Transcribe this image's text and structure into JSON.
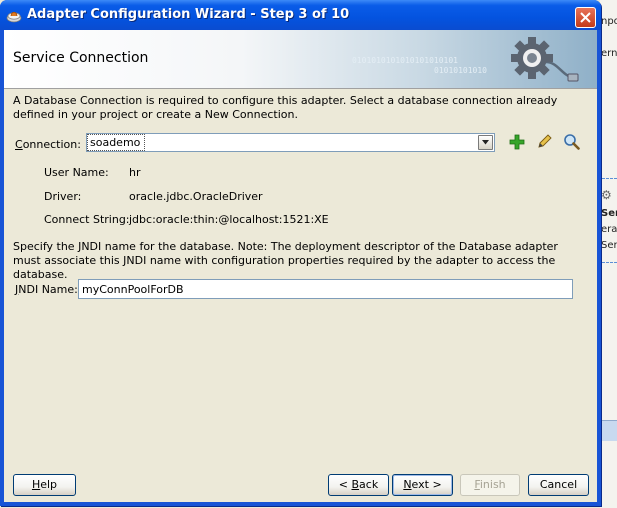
{
  "window": {
    "title": "Adapter Configuration Wizard - Step 3 of 10",
    "icon": "adapter-app-icon"
  },
  "header": {
    "title": "Service Connection",
    "binary_line1": "0101010101010101010101",
    "binary_line2": "01010101010",
    "icon": "gear-plug-icon"
  },
  "intro_text": "A Database Connection is required to configure this adapter. Select a database connection already defined in your project or create a New Connection.",
  "connection": {
    "label_mnemonic": "C",
    "label_rest": "onnection:",
    "value": "soademo",
    "actions": [
      "add-icon",
      "edit-icon",
      "search-icon"
    ]
  },
  "properties": [
    {
      "label": "User Name:",
      "value": "hr"
    },
    {
      "label": "Driver:",
      "value": "oracle.jdbc.OracleDriver"
    },
    {
      "label": "Connect String:",
      "value": "jdbc:oracle:thin:@localhost:1521:XE"
    }
  ],
  "jndi": {
    "description": "Specify the JNDI name for the database.  Note: The deployment descriptor of the Database adapter must associate this JNDI name with configuration properties required by the adapter to access the database.",
    "label_mnemonic": "J",
    "label_rest": "NDI Name:",
    "value": "myConnPoolForDB"
  },
  "buttons": {
    "help": {
      "mnemonic": "H",
      "rest": "elp"
    },
    "back": {
      "prefix": "< ",
      "mnemonic": "B",
      "rest": "ack"
    },
    "next": {
      "mnemonic": "N",
      "rest": "ext >"
    },
    "finish": {
      "mnemonic": "F",
      "rest": "inish"
    },
    "cancel": "Cancel"
  },
  "background_app": {
    "snippets": [
      "npo",
      "ern",
      "Ser",
      "era",
      "Ser"
    ]
  },
  "colors": {
    "titlebar": "#0a5ce8",
    "add_green": "#2e9c1e",
    "field_border": "#7f9db9",
    "button_border": "#003c74"
  }
}
